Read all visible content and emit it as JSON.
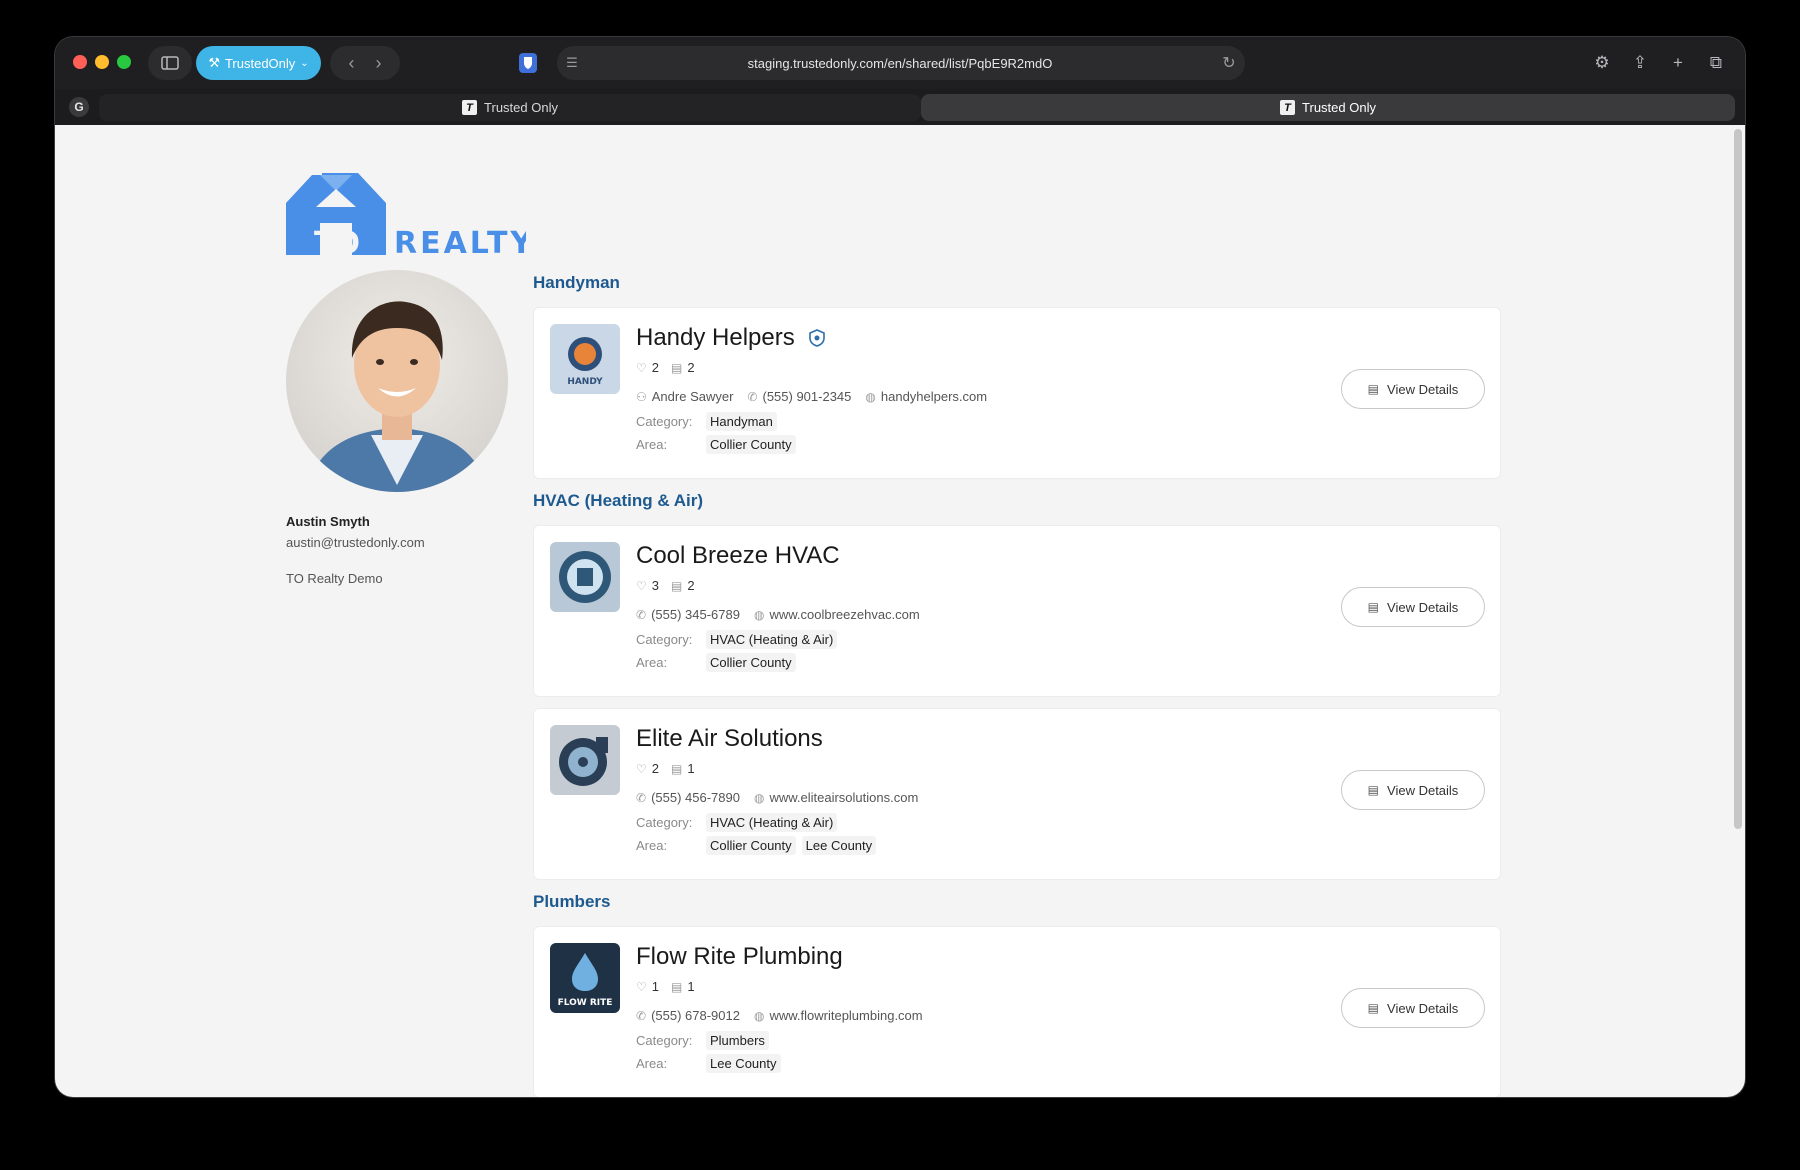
{
  "browser": {
    "profile_label": "TrustedOnly",
    "url": "staging.trustedonly.com/en/shared/list/PqbE9R2mdO",
    "tabs": [
      {
        "label": "Trusted Only"
      },
      {
        "label": "Trusted Only"
      }
    ]
  },
  "brand": {
    "logo_text_1": "TO",
    "logo_text_2": "REALTY",
    "logo_color": "#4a8fe7"
  },
  "user": {
    "name": "Austin Smyth",
    "email": "austin@trustedonly.com",
    "org": "TO Realty Demo"
  },
  "labels": {
    "category": "Category:",
    "area": "Area:",
    "view_details": "View Details"
  },
  "sections": [
    {
      "title": "Handyman"
    },
    {
      "title": "HVAC (Heating & Air)"
    },
    {
      "title": "Plumbers"
    }
  ],
  "vendors": [
    {
      "name": "Handy Helpers",
      "verified": true,
      "likes": "2",
      "notes": "2",
      "contact_name": "Andre Sawyer",
      "phone": "(555) 901-2345",
      "website": "handyhelpers.com",
      "category": "Handyman",
      "areas": [
        "Collier County"
      ],
      "thumb_text": "HANDY"
    },
    {
      "name": "Cool Breeze HVAC",
      "likes": "3",
      "notes": "2",
      "phone": "(555) 345-6789",
      "website": "www.coolbreezehvac.com",
      "category": "HVAC (Heating & Air)",
      "areas": [
        "Collier County"
      ]
    },
    {
      "name": "Elite Air Solutions",
      "likes": "2",
      "notes": "1",
      "phone": "(555) 456-7890",
      "website": "www.eliteairsolutions.com",
      "category": "HVAC (Heating & Air)",
      "areas": [
        "Collier County",
        "Lee County"
      ]
    },
    {
      "name": "Flow Rite Plumbing",
      "likes": "1",
      "notes": "1",
      "phone": "(555) 678-9012",
      "website": "www.flowriteplumbing.com",
      "category": "Plumbers",
      "areas": [
        "Lee County"
      ],
      "thumb_text": "FLOW RITE"
    }
  ]
}
